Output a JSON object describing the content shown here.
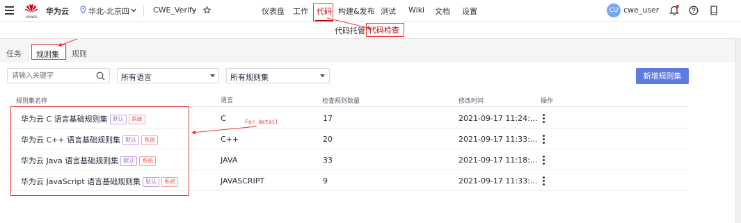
{
  "topbar": {
    "brand": "华为云",
    "logo_text": "HUAWEI",
    "region": "华北-北京四",
    "project": "CWE_Verify",
    "nav": [
      "仪表盘",
      "工作",
      "代码",
      "构建&发布",
      "测试",
      "Wiki",
      "文档",
      "设置"
    ],
    "avatar": "CU",
    "username": "cwe_user"
  },
  "subnav": {
    "items": [
      "代码托管",
      "代码检查"
    ]
  },
  "tabs": [
    "任务",
    "规则集",
    "规则"
  ],
  "toolbar": {
    "search_placeholder": "请输入关键字",
    "language_select": "所有语言",
    "ruleset_select": "所有规则集",
    "new_button": "新增规则集"
  },
  "table": {
    "headers": [
      "规则集名称",
      "语言",
      "检查规则数量",
      "修改时间",
      "操作"
    ],
    "rows": [
      {
        "name": "华为云 C 语言基础规则集",
        "language": "C",
        "count": "17",
        "modified": "2021-09-17 11:24:..."
      },
      {
        "name": "华为云 C++ 语言基础规则集",
        "language": "C++",
        "count": "20",
        "modified": "2021-09-17 11:33:..."
      },
      {
        "name": "华为云 Java 语言基础规则集",
        "language": "JAVA",
        "count": "33",
        "modified": "2021-09-17 11:18:..."
      },
      {
        "name": "华为云 JavaScript 语言基础规则集",
        "language": "JAVASCRIPT",
        "count": "9",
        "modified": "2021-09-17 11:33:..."
      }
    ],
    "badge_default": "默认",
    "badge_system": "系统",
    "action_icon": "more-vertical-icon"
  },
  "annotation": {
    "text": "For detail"
  },
  "colors": {
    "accent": "#5e7ce0",
    "active_nav": "#c7000b",
    "annotation_red": "#e53935",
    "avatar_bg": "#76a8f5"
  }
}
